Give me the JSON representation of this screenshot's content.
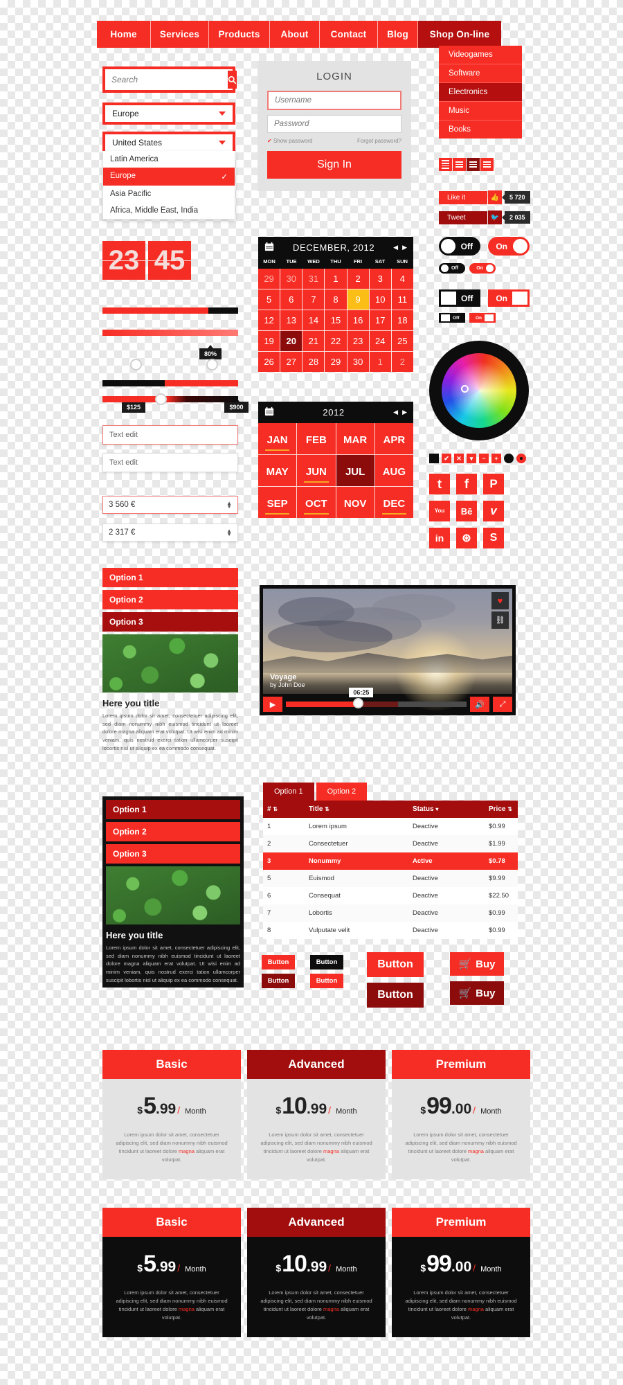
{
  "nav": {
    "items": [
      "Home",
      "Services",
      "Products",
      "About",
      "Contact",
      "Blog"
    ],
    "shop_label": "Shop On-line",
    "dropdown": [
      "Videogames",
      "Software",
      "Electronics",
      "Music",
      "Books"
    ],
    "dropdown_active": "Electronics"
  },
  "search": {
    "placeholder": "Search",
    "icon": "search-icon"
  },
  "region_select": {
    "value": "Europe",
    "options": [
      "United States",
      "Latin America",
      "Europe",
      "Asia Pacific",
      "Africa, Middle East, India"
    ],
    "selected": "Europe",
    "check": "✓"
  },
  "login": {
    "title": "LOGIN",
    "username_placeholder": "Username",
    "password_placeholder": "Password",
    "show_password": "Show password",
    "forgot_password": "Forgot password?",
    "submit": "Sign In"
  },
  "flipclock": {
    "hours": "23",
    "minutes": "45"
  },
  "sliders": {
    "progress_pct": 80,
    "progress_label": "80%",
    "range_low": "$125",
    "range_high": "$900",
    "bar1_fill": 78,
    "range_knob1": 46,
    "range_knob2": 78,
    "single_knob": 48
  },
  "textfields": {
    "edit1": "Text edit",
    "edit2": "Text edit",
    "spin1": "3 560 €",
    "spin2": "2 317 €"
  },
  "accordion_light": {
    "items": [
      "Option 1",
      "Option 2",
      "Option 3"
    ],
    "active": "Option 3"
  },
  "accordion_dark": {
    "items": [
      "Option 1",
      "Option 2",
      "Option 3"
    ],
    "active": "Option 1"
  },
  "content": {
    "title": "Here you title",
    "text": "Lorem ipsum dolor sit amet, consectetuer adipiscing elit, sed diam nonummy nibh euismod tincidunt ut laoreet dolore magna aliquam erat volutpat. Ut wisi enim ad minim veniam, quis nostrud exerci tation ullamcorper suscipit lobortis nisl ut aliquip ex ea commodo consequat."
  },
  "calendar": {
    "title": "DECEMBER, 2012",
    "dow": [
      "MON",
      "TUE",
      "WED",
      "THU",
      "FRI",
      "SAT",
      "SUN"
    ],
    "days": [
      {
        "d": "29",
        "s": "muted"
      },
      {
        "d": "30",
        "s": "muted"
      },
      {
        "d": "31",
        "s": "muted"
      },
      {
        "d": "1",
        "s": ""
      },
      {
        "d": "2",
        "s": ""
      },
      {
        "d": "3",
        "s": ""
      },
      {
        "d": "4",
        "s": ""
      },
      {
        "d": "5",
        "s": ""
      },
      {
        "d": "6",
        "s": ""
      },
      {
        "d": "7",
        "s": ""
      },
      {
        "d": "8",
        "s": ""
      },
      {
        "d": "9",
        "s": "today"
      },
      {
        "d": "10",
        "s": ""
      },
      {
        "d": "11",
        "s": ""
      },
      {
        "d": "12",
        "s": ""
      },
      {
        "d": "13",
        "s": ""
      },
      {
        "d": "14",
        "s": ""
      },
      {
        "d": "15",
        "s": ""
      },
      {
        "d": "16",
        "s": ""
      },
      {
        "d": "17",
        "s": ""
      },
      {
        "d": "18",
        "s": ""
      },
      {
        "d": "19",
        "s": ""
      },
      {
        "d": "20",
        "s": "sel"
      },
      {
        "d": "21",
        "s": ""
      },
      {
        "d": "22",
        "s": ""
      },
      {
        "d": "23",
        "s": ""
      },
      {
        "d": "24",
        "s": ""
      },
      {
        "d": "25",
        "s": ""
      },
      {
        "d": "26",
        "s": ""
      },
      {
        "d": "27",
        "s": ""
      },
      {
        "d": "28",
        "s": ""
      },
      {
        "d": "29",
        "s": ""
      },
      {
        "d": "30",
        "s": ""
      },
      {
        "d": "1",
        "s": "muted"
      },
      {
        "d": "2",
        "s": "muted"
      }
    ],
    "prev": "◀",
    "next": "▶",
    "icon": "calendar-icon"
  },
  "yearcal": {
    "title": "2012",
    "months": [
      {
        "m": "JAN",
        "s": "ul"
      },
      {
        "m": "FEB",
        "s": ""
      },
      {
        "m": "MAR",
        "s": ""
      },
      {
        "m": "APR",
        "s": ""
      },
      {
        "m": "MAY",
        "s": ""
      },
      {
        "m": "JUN",
        "s": "ul"
      },
      {
        "m": "JUL",
        "s": "sel"
      },
      {
        "m": "AUG",
        "s": ""
      },
      {
        "m": "SEP",
        "s": "ul"
      },
      {
        "m": "OCT",
        "s": "ul"
      },
      {
        "m": "NOV",
        "s": ""
      },
      {
        "m": "DEC",
        "s": "ul"
      }
    ],
    "prev": "◀",
    "next": "▶"
  },
  "viewtoggle": {
    "count": 4,
    "active_index": 2
  },
  "social_counters": {
    "like_label": "Like it",
    "like_count": "5 720",
    "tweet_label": "Tweet",
    "tweet_count": "2 035"
  },
  "toggles": {
    "off_label": "Off",
    "on_label": "On",
    "small_off": "Off",
    "small_on": "On"
  },
  "colorwheel": {
    "label": "color-wheel"
  },
  "controls": [
    "square",
    "check",
    "close",
    "caret-down",
    "minus",
    "plus",
    "dot-black",
    "dot-red"
  ],
  "social_icons": [
    [
      "twitter-icon",
      "facebook-icon",
      "pinterest-icon"
    ],
    [
      "youtube-icon",
      "behance-icon",
      "vimeo-icon"
    ],
    [
      "linkedin-icon",
      "dribbble-icon",
      "skype-icon"
    ]
  ],
  "social_glyphs": [
    [
      "t",
      "f",
      "P"
    ],
    [
      "You",
      "Bē",
      "v"
    ],
    [
      "in",
      "⊛",
      "S"
    ]
  ],
  "video": {
    "title": "Voyage",
    "author": "by John Doe",
    "time": "06:25",
    "play": "▶",
    "volume": "🔊",
    "fullscreen": "⤢",
    "like": "♥",
    "link": "🔗"
  },
  "table": {
    "tabs": [
      "Option 1",
      "Option 2"
    ],
    "active_tab": "Option 1",
    "columns": [
      "#",
      "Title",
      "Status",
      "Price"
    ],
    "sort_icon": "sort-arrows-icon",
    "rows": [
      {
        "n": "1",
        "title": "Lorem ipsum",
        "status": "Deactive",
        "price": "$0.99",
        "sel": false
      },
      {
        "n": "2",
        "title": "Consectetuer",
        "status": "Deactive",
        "price": "$1.99",
        "sel": false
      },
      {
        "n": "3",
        "title": "Nonummy",
        "status": "Active",
        "price": "$0.78",
        "sel": true
      },
      {
        "n": "5",
        "title": "Euismod",
        "status": "Deactive",
        "price": "$9.99",
        "sel": false
      },
      {
        "n": "6",
        "title": "Consequat",
        "status": "Deactive",
        "price": "$22.50",
        "sel": false
      },
      {
        "n": "7",
        "title": "Lobortis",
        "status": "Deactive",
        "price": "$0.99",
        "sel": false
      },
      {
        "n": "8",
        "title": "Vulputate velit",
        "status": "Deactive",
        "price": "$0.99",
        "sel": false
      }
    ]
  },
  "buttons": {
    "small": "Button",
    "large": "Button",
    "buy": "Buy",
    "cart_icon": "cart-icon"
  },
  "pricing": {
    "text": "Lorem ipsum dolor sit amet, consectetuer adipiscing elit, sed diam nonummy nibh euismod tincidunt ut laoreet dolore magna aliquam erat volutpat.",
    "magna": "magna",
    "per": "Month",
    "currency": "$",
    "plans": [
      {
        "name": "Basic",
        "int": "5",
        "dec": ".99"
      },
      {
        "name": "Advanced",
        "int": "10",
        "dec": ".99"
      },
      {
        "name": "Premium",
        "int": "99",
        "dec": ".00"
      }
    ]
  },
  "colors": {
    "primary": "#f62d24",
    "dark_red": "#8c0c0c",
    "black": "#0d0d0d",
    "gray": "#e3e3e3",
    "yellow": "#fbbe17"
  }
}
